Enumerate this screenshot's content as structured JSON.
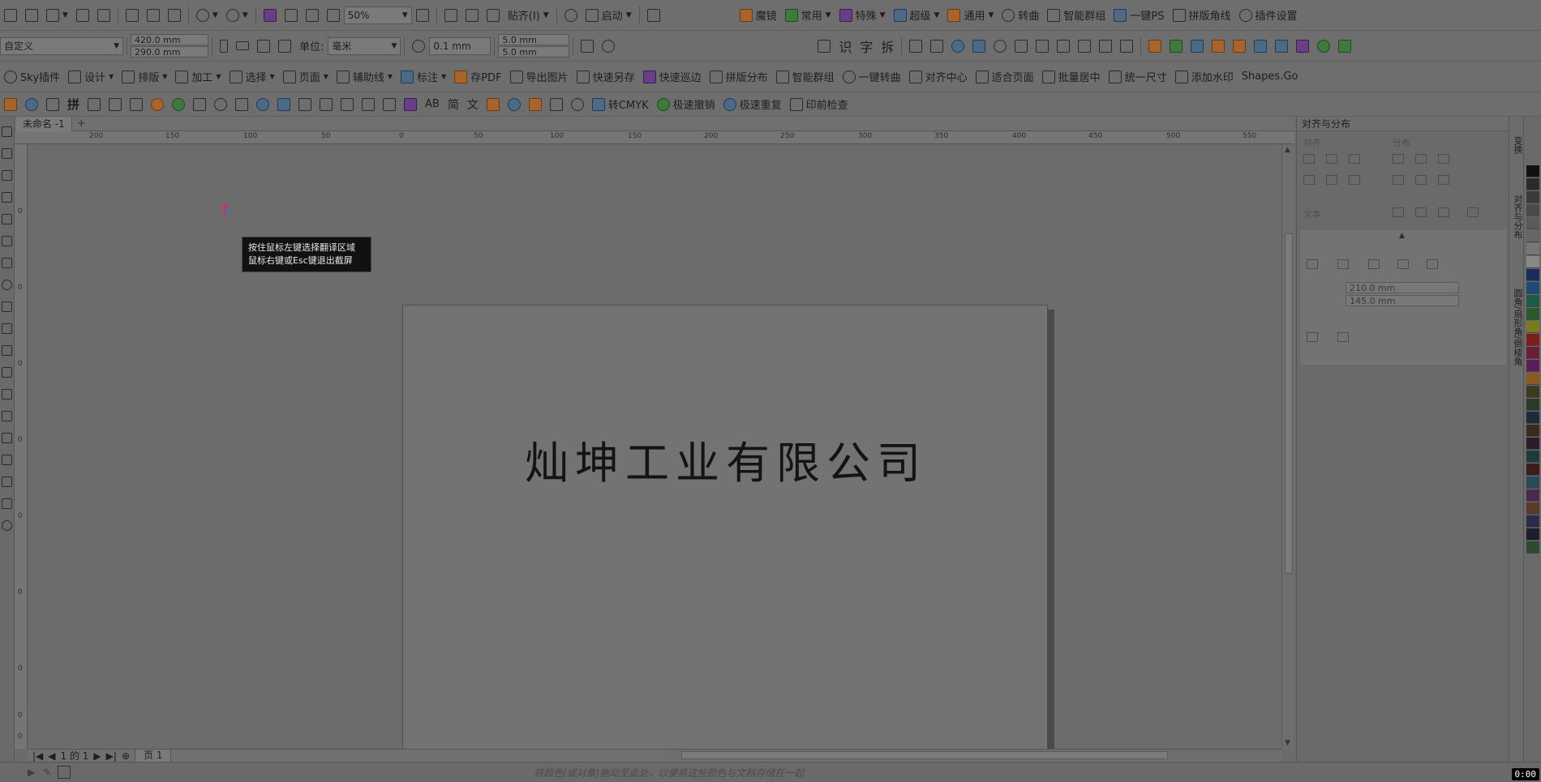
{
  "toolbar1": {
    "zoom": "50%",
    "snap_label": "贴齐(I)",
    "launch_label": "启动",
    "plugins": [
      "魔镜",
      "常用",
      "特殊",
      "超级",
      "通用",
      "转曲",
      "智能群组",
      "一键PS",
      "拼版角线",
      "插件设置"
    ]
  },
  "toolbar2": {
    "page_preset": "自定义",
    "width": "420.0 mm",
    "height": "290.0 mm",
    "unit_label": "单位:",
    "unit_value": "毫米",
    "nudge": "0.1 mm",
    "dup_x": "5.0 mm",
    "dup_y": "5.0 mm",
    "text_tools": [
      "识",
      "字",
      "拆"
    ]
  },
  "toolbar3": {
    "items": [
      "Sky插件",
      "设计",
      "排版",
      "加工",
      "选择",
      "页面",
      "辅助线",
      "标注",
      "存PDF",
      "导出图片",
      "快速另存",
      "快速巡边",
      "拼版分布",
      "智能群组",
      "一键转曲",
      "对齐中心",
      "适合页面",
      "批量居中",
      "统一尺寸",
      "添加水印",
      "Shapes.Go"
    ]
  },
  "toolbar4": {
    "glyphs": [
      "拼",
      "AB",
      "简",
      "文"
    ],
    "items": [
      "转CMYK",
      "极速撤销",
      "极速重复",
      "印前检查"
    ]
  },
  "document": {
    "tab_name": "未命名 -1",
    "company_text": "灿坤工业有限公司"
  },
  "rulers": {
    "h_ticks": [
      "200",
      "150",
      "100",
      "50",
      "0",
      "50",
      "100",
      "150",
      "200",
      "250",
      "300",
      "350",
      "400",
      "450",
      "500",
      "550"
    ],
    "v_ticks": [
      "0",
      "0",
      "0",
      "0",
      "0",
      "0",
      "0",
      "0",
      "0"
    ]
  },
  "tooltip": {
    "line1": "按住鼠标左键选择翻译区域",
    "line2": "鼠标右键或Esc键退出截屏"
  },
  "pager": {
    "page_info": "1 的 1",
    "page_tab": "页 1"
  },
  "status": {
    "hint": "将颜色(或对象)拖动至此处，以便将这些颜色与文档存储在一起"
  },
  "docker": {
    "title": "对齐与分布",
    "align_label": "对齐",
    "distribute_label": "分布",
    "text_label": "文本",
    "size_w": "210.0 mm",
    "size_h": "145.0 mm",
    "vtabs": [
      "变换",
      "对齐与分布",
      "圆角/扇形角/倒棱角"
    ]
  },
  "palette": {
    "colors": [
      "#111111",
      "#2a2a2a",
      "#3a3a3a",
      "#4a4a4a",
      "#5a5a5a",
      "#666666",
      "#777777",
      "#888888",
      "#1a2a5a",
      "#1e4a7a",
      "#1e5a4a",
      "#2a5a2a",
      "#7a7a1e",
      "#7a1e1e",
      "#6a1e3a",
      "#5a1e5a",
      "#8a5a1e",
      "#3a3a1e",
      "#2a3a2a",
      "#1e2a3a",
      "#3a2a1e",
      "#2a1e2a",
      "#1e3a3a",
      "#3a1e1e",
      "#2a4a5a",
      "#4a2a4a",
      "#5a3a2a",
      "#2a2a4a",
      "#1e1e2a",
      "#2e4a2e"
    ],
    "time": "0:00"
  }
}
